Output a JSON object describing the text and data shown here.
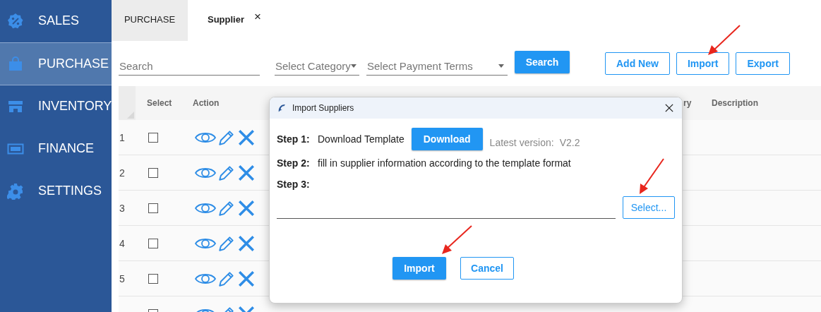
{
  "sidebar": {
    "items": [
      {
        "label": "SALES",
        "selected": false
      },
      {
        "label": "PURCHASE",
        "selected": true
      },
      {
        "label": "INVENTORY",
        "selected": false
      },
      {
        "label": "FINANCE",
        "selected": false
      },
      {
        "label": "SETTINGS",
        "selected": false
      }
    ]
  },
  "tabs": [
    {
      "label": "PURCHASE",
      "selected": false
    },
    {
      "label": "Supplier",
      "selected": true,
      "close": "×"
    }
  ],
  "toolbar": {
    "search": {
      "placeholder": "Search"
    },
    "category": {
      "placeholder": "Select Category"
    },
    "payment_terms": {
      "placeholder": "Select Payment Terms"
    },
    "search_button": "Search",
    "buttons": [
      "Add New",
      "Import",
      "Export"
    ]
  },
  "table": {
    "columns": [
      "Select",
      "Action",
      "ry",
      "Description"
    ],
    "rows": [
      {
        "number": "1",
        "checked": false
      },
      {
        "number": "2",
        "checked": false
      },
      {
        "number": "3",
        "checked": false
      },
      {
        "number": "4",
        "checked": false
      },
      {
        "number": "5",
        "checked": false
      },
      {
        "checked": false
      }
    ]
  },
  "dialog": {
    "title": "Import Suppliers",
    "steps": [
      {
        "label": "Step 1:",
        "text": "Download Template"
      },
      {
        "label": "Step 2:",
        "text": "fill in supplier information according to the template format"
      },
      {
        "label": "Step 3:"
      }
    ],
    "download_button": "Download",
    "version_label": "Latest version:",
    "version": "V2.2",
    "select_button": "Select...",
    "buttons": [
      {
        "label": "Import",
        "kind": "primary"
      },
      {
        "label": "Cancel",
        "kind": "outline"
      }
    ]
  }
}
